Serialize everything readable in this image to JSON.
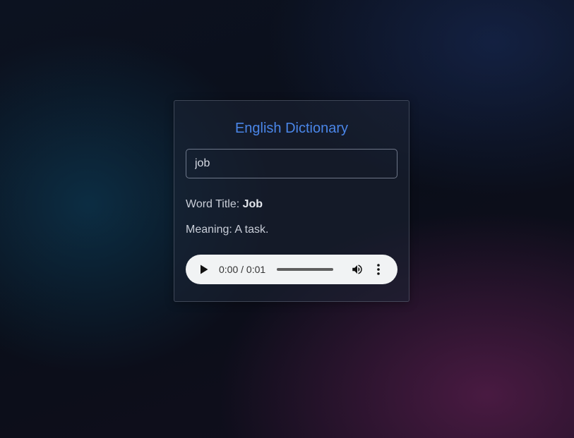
{
  "app": {
    "title": "English Dictionary"
  },
  "search": {
    "value": "job",
    "placeholder": ""
  },
  "result": {
    "word_label": "Word Title: ",
    "word": "Job",
    "meaning_label": "Meaning: ",
    "meaning": "A task."
  },
  "audio": {
    "time_display": "0:00 / 0:01",
    "progress": 0,
    "icons": {
      "play": "play-icon",
      "volume": "volume-icon",
      "more": "more-vert-icon"
    }
  },
  "colors": {
    "accent": "#4a86e8",
    "background": "#0b0f1a",
    "card_border": "#5a6272",
    "player_bg": "#f1f3f4"
  }
}
